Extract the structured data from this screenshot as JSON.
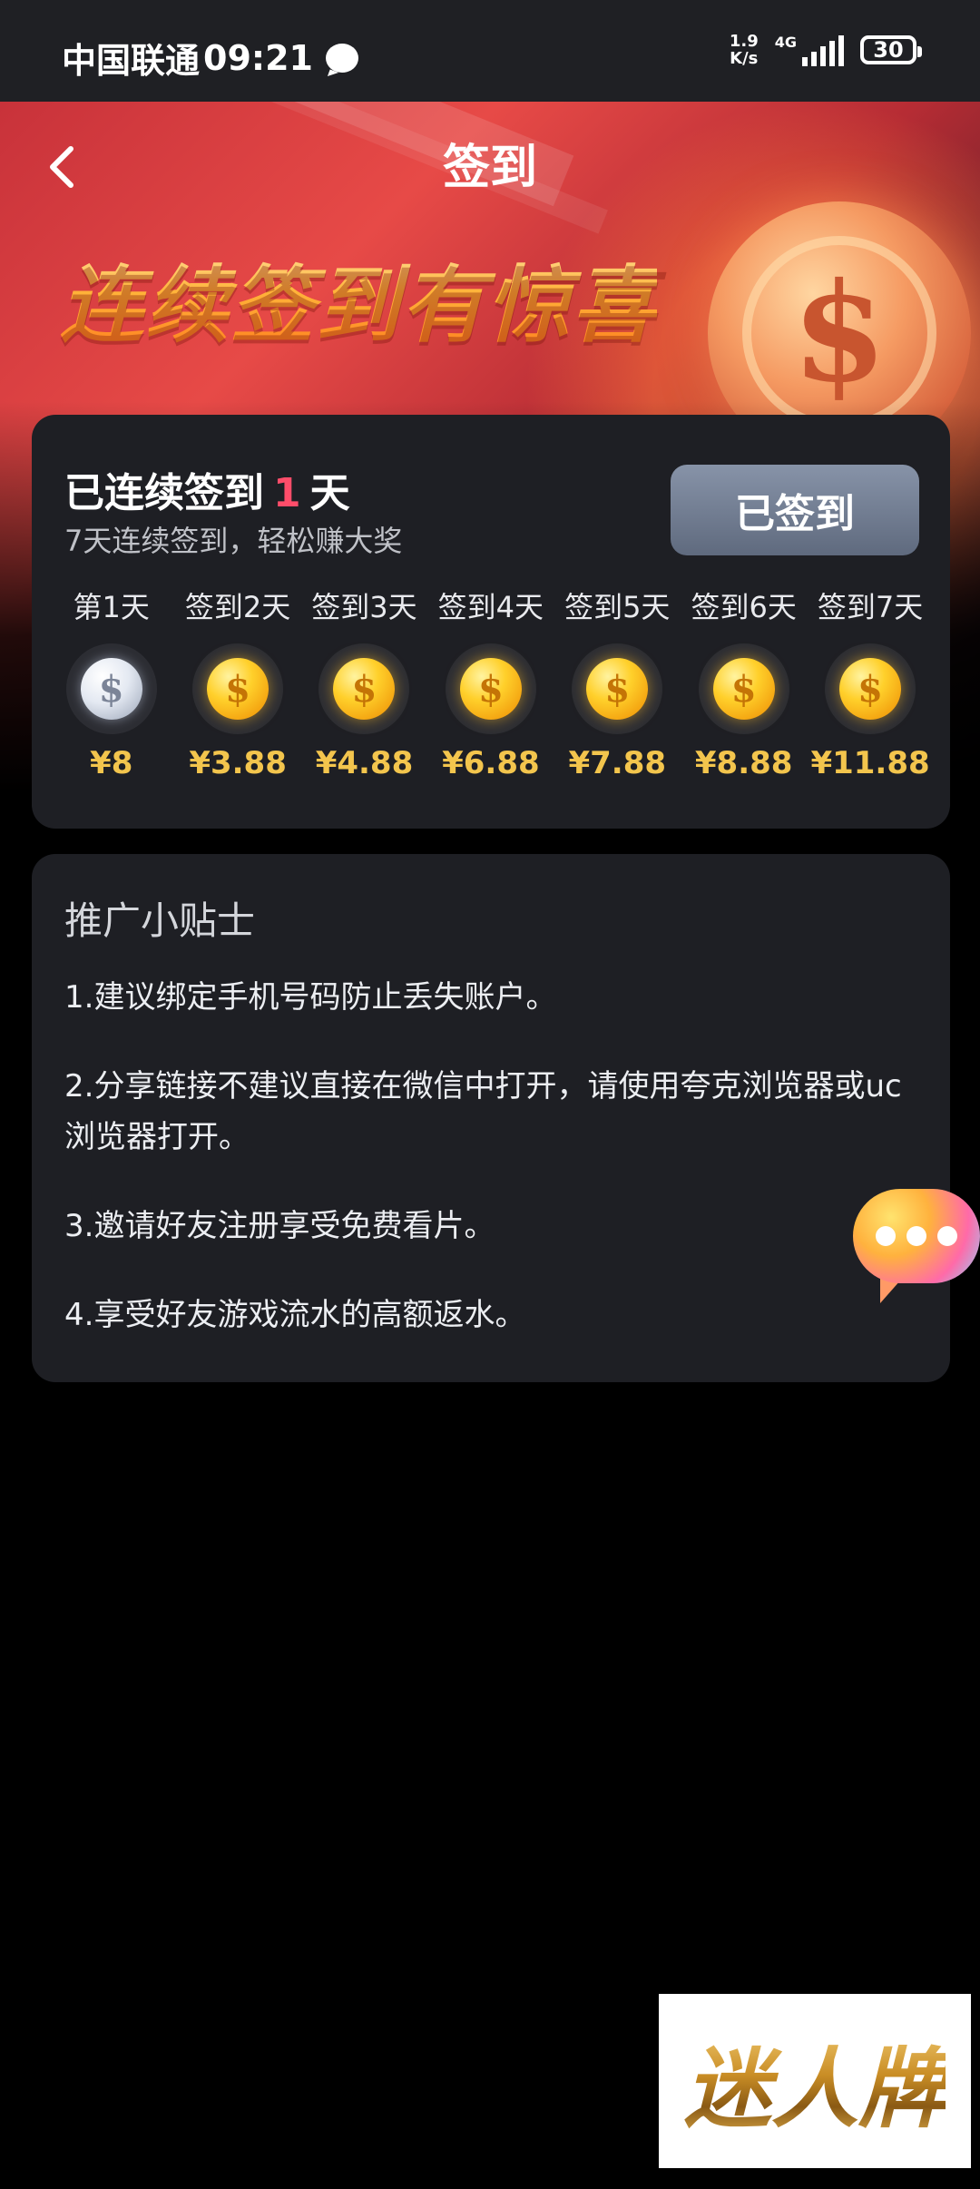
{
  "status_bar": {
    "carrier": "中国联通",
    "time": "09:21",
    "net_speed_value": "1.9",
    "net_speed_unit": "K/s",
    "network_type": "4G",
    "battery": "30"
  },
  "header": {
    "title": "签到",
    "slogan": "连续签到有惊喜"
  },
  "sign_card": {
    "streak_prefix": "已连续签到",
    "streak_days": "1",
    "streak_suffix": "天",
    "subtitle": "7天连续签到，轻松赚大奖",
    "button_label": "已签到",
    "days": [
      {
        "label": "第1天",
        "reward": "¥8",
        "coin": "silver"
      },
      {
        "label": "签到2天",
        "reward": "¥3.88",
        "coin": "gold"
      },
      {
        "label": "签到3天",
        "reward": "¥4.88",
        "coin": "gold"
      },
      {
        "label": "签到4天",
        "reward": "¥6.88",
        "coin": "gold"
      },
      {
        "label": "签到5天",
        "reward": "¥7.88",
        "coin": "gold"
      },
      {
        "label": "签到6天",
        "reward": "¥8.88",
        "coin": "gold"
      },
      {
        "label": "签到7天",
        "reward": "¥11.88",
        "coin": "gold"
      }
    ]
  },
  "tips": {
    "title": "推广小贴士",
    "items": [
      "1.建议绑定手机号码防止丢失账户。",
      "2.分享链接不建议直接在微信中打开，请使用夸克浏览器或uc浏览器打开。",
      "3.邀请好友注册享受免费看片。",
      "4.享受好友游戏流水的高额返水。"
    ]
  },
  "watermark": {
    "text": "迷人牌"
  },
  "colors": {
    "accent_red": "#ff4d6a",
    "reward_gold": "#f3c54d",
    "card_bg": "#1e1f24",
    "button_bg": "#6e7a90"
  }
}
